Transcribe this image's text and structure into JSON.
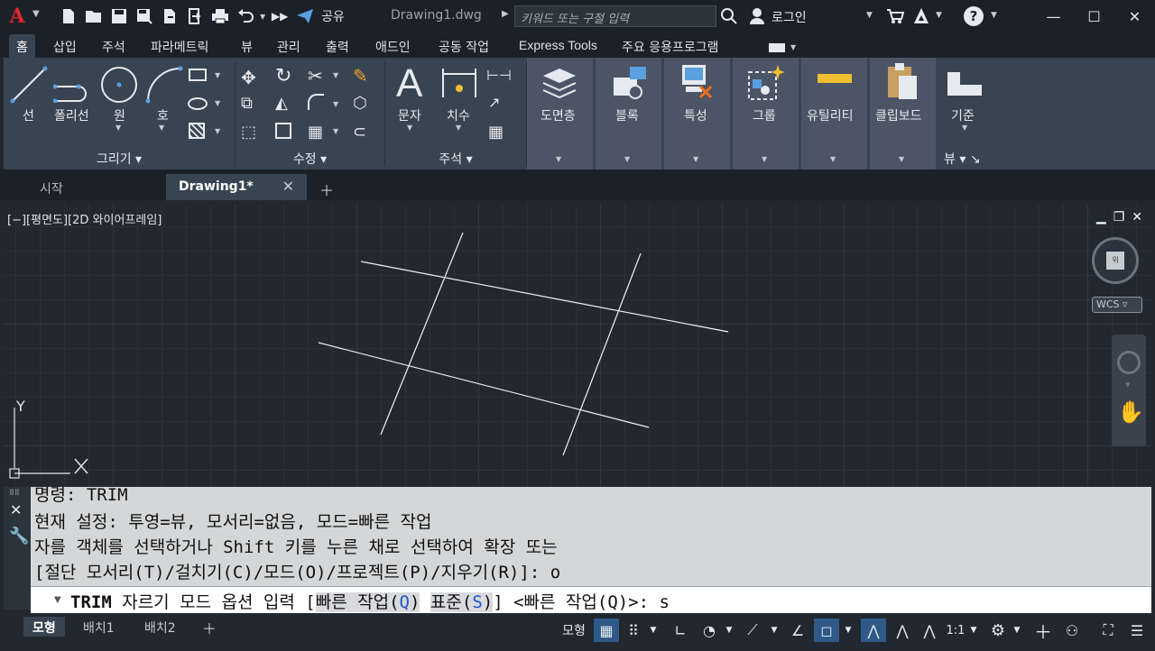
{
  "titlebar": {
    "app_icon": "autocad-logo",
    "share_label": "공유",
    "document_name": "Drawing1.dwg",
    "search_placeholder": "키워드 또는 구절 입력",
    "login_label": "로그인"
  },
  "ribbon_tabs": [
    {
      "label": "홈",
      "active": true
    },
    {
      "label": "삽입"
    },
    {
      "label": "주석"
    },
    {
      "label": "파라메트릭"
    },
    {
      "label": "뷰"
    },
    {
      "label": "관리"
    },
    {
      "label": "출력"
    },
    {
      "label": "애드인"
    },
    {
      "label": "공동 작업"
    },
    {
      "label": "Express Tools"
    },
    {
      "label": "주요 응용프로그램"
    }
  ],
  "ribbon": {
    "draw": {
      "title": "그리기",
      "line": "선",
      "polyline": "폴리선",
      "circle": "원",
      "arc": "호"
    },
    "modify": {
      "title": "수정"
    },
    "annotation": {
      "title": "주석",
      "text": "문자",
      "dimension": "치수"
    },
    "layers": "도면층",
    "block": "블록",
    "properties": "특성",
    "groups": "그룹",
    "utilities": "유틸리티",
    "clipboard": "클립보드",
    "view": {
      "base": "기준",
      "title": "뷰"
    }
  },
  "doc_tabs": [
    {
      "label": "시작"
    },
    {
      "label": "Drawing1*",
      "active": true
    }
  ],
  "viewport": {
    "label": "[−][평면도][2D 와이어프레임]",
    "viewcube_face": "위",
    "wcs": "WCS",
    "ucs_y": "Y"
  },
  "command": {
    "history": [
      "명령: TRIM",
      "현재 설정: 투영=뷰, 모서리=없음, 모드=빠른 작업",
      "자를 객체를 선택하거나 Shift 키를 누른 채로 선택하여 확장 또는",
      " [절단 모서리(T)/걸치기(C)/모드(O)/프로젝트(P)/지우기(R)]: o"
    ],
    "prompt_cmd": "TRIM",
    "prompt_text": "자르기 모드 옵션 입력 [",
    "opt1_text": "빠른 작업(",
    "opt1_key": "Q",
    "opt1_close": ")",
    "opt2_text": "표준(",
    "opt2_key": "S",
    "opt2_close": ")",
    "prompt_tail": "] <빠른 작업(Q)>: s"
  },
  "layout_tabs": [
    {
      "label": "모형",
      "active": true
    },
    {
      "label": "배치1"
    },
    {
      "label": "배치2"
    }
  ],
  "statusbar": {
    "model_label": "모형",
    "scale_label": "1:1"
  }
}
